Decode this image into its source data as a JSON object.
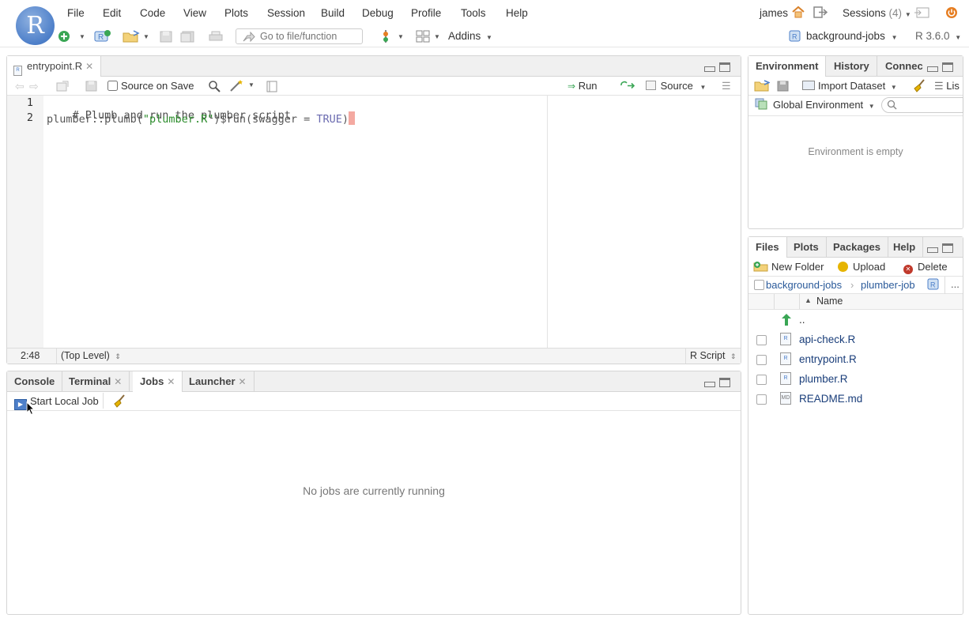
{
  "menubar": {
    "logo_letter": "R",
    "items": [
      "File",
      "Edit",
      "Code",
      "View",
      "Plots",
      "Session",
      "Build",
      "Debug",
      "Profile",
      "Tools",
      "Help"
    ],
    "user": "james",
    "sessions_label": "Sessions",
    "sessions_count": "(4)"
  },
  "toolbar": {
    "goto_placeholder": "Go to file/function",
    "addins_label": "Addins",
    "project_label": "background-jobs",
    "r_version": "R 3.6.0"
  },
  "editor": {
    "tab_label": "entrypoint.R",
    "source_on_save_label": "Source on Save",
    "run_label": "Run",
    "source_label": "Source",
    "lines": [
      {
        "num": "1",
        "comment": "# Plumb and run the plumber script"
      },
      {
        "num": "2",
        "fn": "plumber::plumb(",
        "str": "\"plumber.R\"",
        "mid": ")$run(",
        "arg": "swagger = ",
        "kw": "TRUE",
        "close": ")"
      }
    ],
    "status": {
      "position": "2:48",
      "scope": "(Top Level)",
      "file_type": "R Script"
    }
  },
  "bottom_pane": {
    "tabs": [
      "Console",
      "Terminal",
      "Jobs",
      "Launcher"
    ],
    "start_local_job_label": "Start Local Job",
    "empty_message": "No jobs are currently running"
  },
  "environment": {
    "tabs": [
      "Environment",
      "History",
      "Connec"
    ],
    "import_dataset_label": "Import Dataset",
    "list_label": "Lis",
    "scope_label": "Global Environment",
    "empty_message": "Environment is empty"
  },
  "files": {
    "tabs": [
      "Files",
      "Plots",
      "Packages",
      "Help"
    ],
    "new_folder_label": "New Folder",
    "upload_label": "Upload",
    "delete_label": "Delete",
    "breadcrumb": [
      "background-jobs",
      "plumber-job"
    ],
    "more_label": "...",
    "name_header": "Name",
    "parent_label": "..",
    "items": [
      {
        "name": "api-check.R",
        "type": "R"
      },
      {
        "name": "entrypoint.R",
        "type": "R"
      },
      {
        "name": "plumber.R",
        "type": "R"
      },
      {
        "name": "README.md",
        "type": "MD"
      }
    ]
  }
}
